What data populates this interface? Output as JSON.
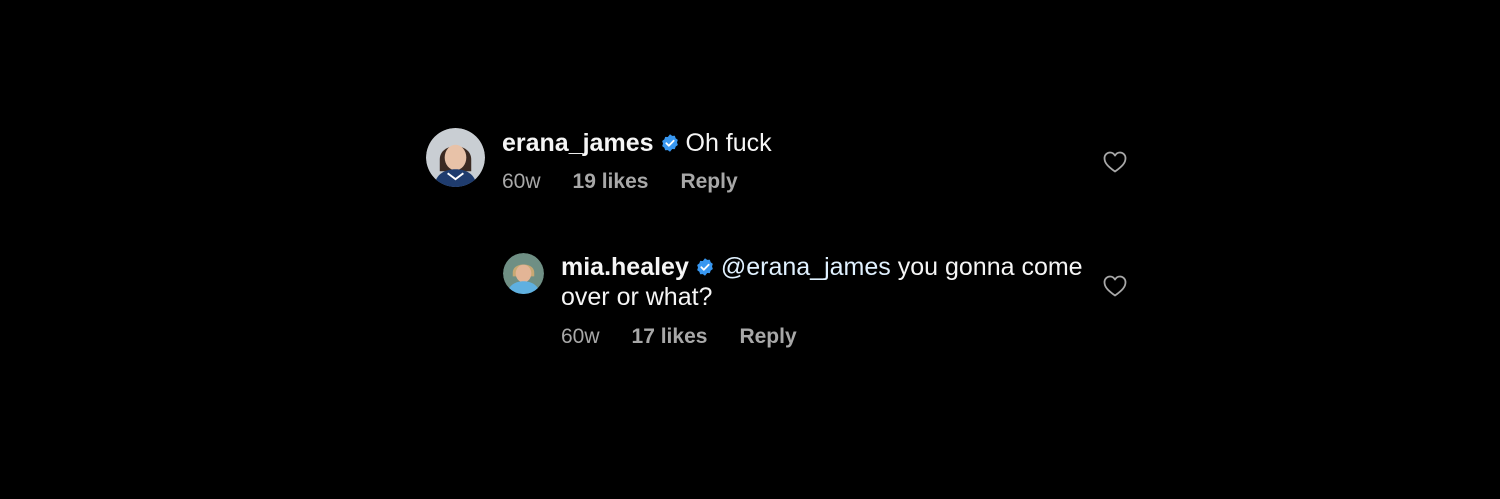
{
  "colors": {
    "background": "#000000",
    "text": "#f5f5f5",
    "meta": "#a8a8a8",
    "verified": "#3897f0",
    "mention": "#e0f1ff"
  },
  "comments": [
    {
      "username": "erana_james",
      "verified": true,
      "text": "Oh fuck",
      "time": "60w",
      "likes": "19 likes",
      "reply_label": "Reply",
      "like_icon": "heart-outline-icon"
    },
    {
      "username": "mia.healey",
      "verified": true,
      "mention": "@erana_james",
      "text": " you gonna come over or what?",
      "time": "60w",
      "likes": "17 likes",
      "reply_label": "Reply",
      "like_icon": "heart-outline-icon"
    }
  ]
}
